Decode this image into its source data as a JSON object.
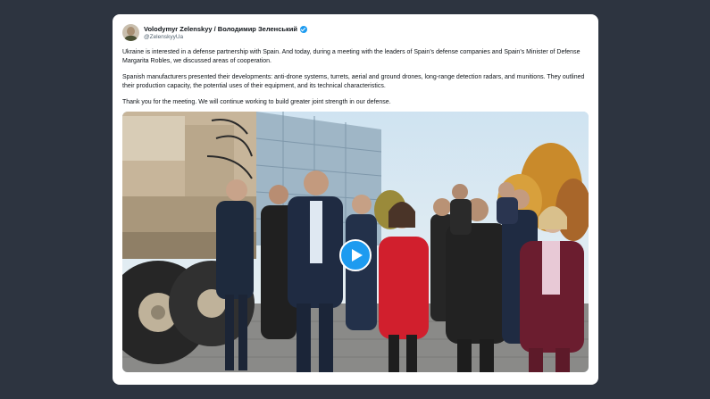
{
  "tweet": {
    "display_name": "Volodymyr Zelenskyy / Володимир Зеленський",
    "handle": "@ZelenskyyUa",
    "paragraphs": [
      "Ukraine is interested in a defense partnership with Spain. And today, during a meeting with the leaders of Spain’s defense companies and Spain’s Minister of Defense Margarita Robles, we discussed areas of cooperation.",
      "Spanish manufacturers presented their developments: anti-drone systems, turrets, aerial and ground drones, long-range detection radars, and munitions. They outlined their production capacity, the potential uses of their equipment, and its technical characteristics.",
      "Thank you for the meeting. We will continue working to build greater joint strength in our defense."
    ],
    "badge_icon": "verified-badge-icon",
    "media_icon": "play-icon"
  },
  "colors": {
    "page_background": "#2d3440",
    "card_background": "#ffffff",
    "accent": "#1d9bf0",
    "text_primary": "#0f1419",
    "text_secondary": "#536471"
  }
}
